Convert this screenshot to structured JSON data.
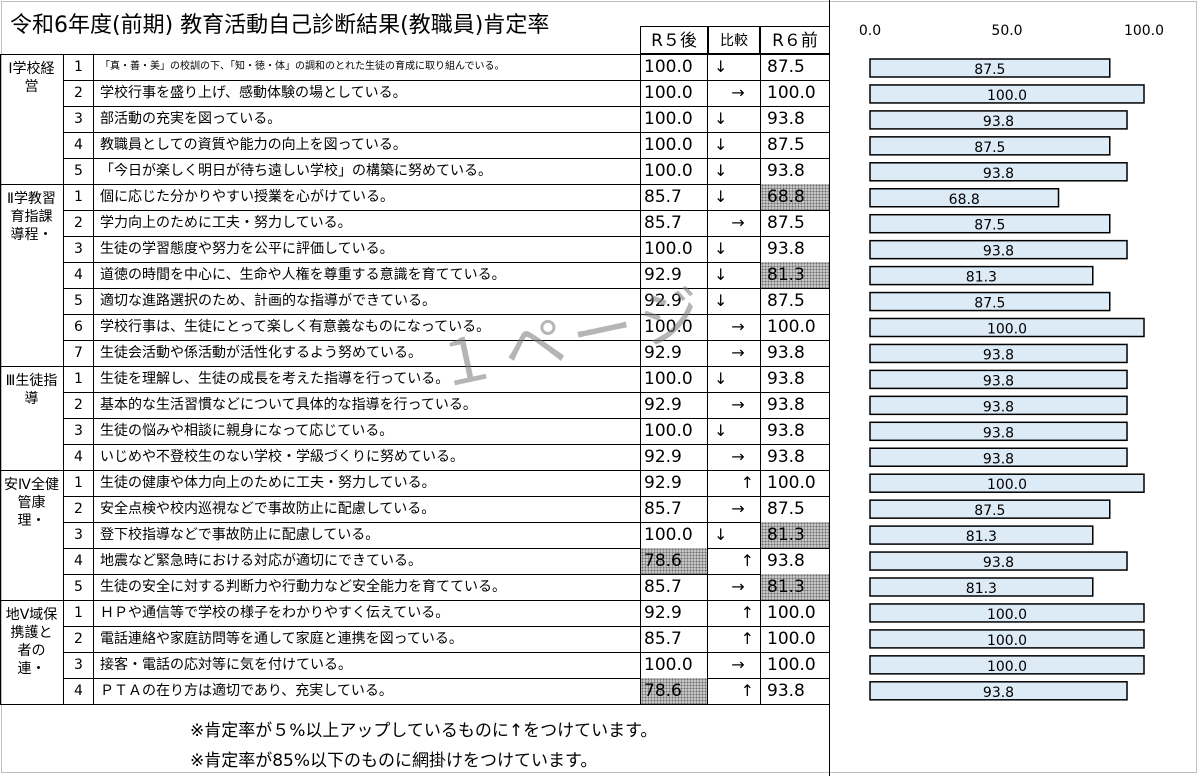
{
  "title": "令和6年度(前期)  教育活動自己診断結果(教職員)肯定率",
  "headers": {
    "r5": "R５後",
    "cmp": "比較",
    "r6": "R６前"
  },
  "categories": [
    {
      "label": "Ⅰ学校経営",
      "rows": [
        {
          "no": "1",
          "item": "「真・善・美」の校訓の下、「知・徳・体」の調和のとれた生徒の育成に取り組んでいる。",
          "small": true,
          "r5": "100.0",
          "cmp": "↓",
          "r6": "87.5"
        },
        {
          "no": "2",
          "item": "学校行事を盛り上げ、感動体験の場としている。",
          "r5": "100.0",
          "cmp": "→",
          "r6": "100.0"
        },
        {
          "no": "3",
          "item": "部活動の充実を図っている。",
          "r5": "100.0",
          "cmp": "↓",
          "r6": "93.8"
        },
        {
          "no": "4",
          "item": "教職員としての資質や能力の向上を図っている。",
          "r5": "100.0",
          "cmp": "↓",
          "r6": "87.5"
        },
        {
          "no": "5",
          "item": "「今日が楽しく明日が待ち遠しい学校」の構築に努めている。",
          "r5": "100.0",
          "cmp": "↓",
          "r6": "93.8"
        }
      ]
    },
    {
      "label": "Ⅱ学教習育指課導程・",
      "rows": [
        {
          "no": "1",
          "item": "個に応じた分かりやすい授業を心がけている。",
          "r5": "85.7",
          "cmp": "↓",
          "r6": "68.8",
          "r6_shade": true
        },
        {
          "no": "2",
          "item": "学力向上のために工夫・努力している。",
          "r5": "85.7",
          "cmp": "→",
          "r6": "87.5"
        },
        {
          "no": "3",
          "item": "生徒の学習態度や努力を公平に評価している。",
          "r5": "100.0",
          "cmp": "↓",
          "r6": "93.8"
        },
        {
          "no": "4",
          "item": "道徳の時間を中心に、生命や人権を尊重する意識を育てている。",
          "r5": "92.9",
          "cmp": "↓",
          "r6": "81.3",
          "r6_shade": true
        },
        {
          "no": "5",
          "item": "適切な進路選択のため、計画的な指導ができている。",
          "r5": "92.9",
          "cmp": "↓",
          "r6": "87.5"
        },
        {
          "no": "6",
          "item": "学校行事は、生徒にとって楽しく有意義なものになっている。",
          "r5": "100.0",
          "cmp": "→",
          "r6": "100.0"
        },
        {
          "no": "7",
          "item": "生徒会活動や係活動が活性化するよう努めている。",
          "r5": "92.9",
          "cmp": "→",
          "r6": "93.8"
        }
      ]
    },
    {
      "label": "Ⅲ生徒指導",
      "rows": [
        {
          "no": "1",
          "item": "生徒を理解し、生徒の成長を考えた指導を行っている。",
          "r5": "100.0",
          "cmp": "↓",
          "r6": "93.8"
        },
        {
          "no": "2",
          "item": "基本的な生活習慣などについて具体的な指導を行っている。",
          "r5": "92.9",
          "cmp": "→",
          "r6": "93.8"
        },
        {
          "no": "3",
          "item": "生徒の悩みや相談に親身になって応じている。",
          "r5": "100.0",
          "cmp": "↓",
          "r6": "93.8"
        },
        {
          "no": "4",
          "item": "いじめや不登校生のない学校・学級づくりに努めている。",
          "r5": "92.9",
          "cmp": "→",
          "r6": "93.8"
        }
      ]
    },
    {
      "label": "安Ⅳ全健管康理・",
      "rows": [
        {
          "no": "1",
          "item": "生徒の健康や体力向上のために工夫・努力している。",
          "r5": "92.9",
          "cmp": "↑",
          "r6": "100.0"
        },
        {
          "no": "2",
          "item": "安全点検や校内巡視などで事故防止に配慮している。",
          "r5": "85.7",
          "cmp": "→",
          "r6": "87.5"
        },
        {
          "no": "3",
          "item": "登下校指導などで事故防止に配慮している。",
          "r5": "100.0",
          "cmp": "↓",
          "r6": "81.3",
          "r6_shade": true
        },
        {
          "no": "4",
          "item": "地震など緊急時における対応が適切にできている。",
          "r5": "78.6",
          "r5_shade": true,
          "cmp": "↑",
          "r6": "93.8"
        },
        {
          "no": "5",
          "item": "生徒の安全に対する判断力や行動力など安全能力を育てている。",
          "r5": "85.7",
          "cmp": "→",
          "r6": "81.3",
          "r6_shade": true
        }
      ]
    },
    {
      "label": "地Ⅴ域保携護と者の連・",
      "rows": [
        {
          "no": "1",
          "item": "ＨＰや通信等で学校の様子をわかりやすく伝えている。",
          "r5": "92.9",
          "cmp": "↑",
          "r6": "100.0"
        },
        {
          "no": "2",
          "item": "電話連絡や家庭訪問等を通して家庭と連携を図っている。",
          "r5": "85.7",
          "cmp": "↑",
          "r6": "100.0"
        },
        {
          "no": "3",
          "item": "接客・電話の応対等に気を付けている。",
          "r5": "100.0",
          "cmp": "→",
          "r6": "100.0"
        },
        {
          "no": "4",
          "item": "ＰＴＡの在り方は適切であり、充実している。",
          "r5": "78.6",
          "r5_shade": true,
          "cmp": "↑",
          "r6": "93.8"
        }
      ]
    }
  ],
  "notes": [
    "※肯定率が５%以上アップしているものに↑をつけています。",
    "※肯定率が85%以下のものに網掛けをつけています。"
  ],
  "watermark": "１ページ",
  "chart_data": {
    "type": "bar",
    "orientation": "horizontal",
    "title": "",
    "xlabel": "",
    "ylabel": "",
    "xlim": [
      0,
      100
    ],
    "x_ticks": [
      "0.0",
      "50.0",
      "100.0"
    ],
    "grid": false,
    "bar_color": "#ddebf7",
    "values": [
      87.5,
      100.0,
      93.8,
      87.5,
      93.8,
      68.8,
      87.5,
      93.8,
      81.3,
      87.5,
      100.0,
      93.8,
      93.8,
      93.8,
      93.8,
      93.8,
      100.0,
      87.5,
      81.3,
      93.8,
      81.3,
      100.0,
      100.0,
      100.0,
      93.8
    ],
    "labels": [
      "87.5",
      "100.0",
      "93.8",
      "87.5",
      "93.8",
      "68.8",
      "87.5",
      "93.8",
      "81.3",
      "87.5",
      "100.0",
      "93.8",
      "93.8",
      "93.8",
      "93.8",
      "93.8",
      "100.0",
      "87.5",
      "81.3",
      "93.8",
      "81.3",
      "100.0",
      "100.0",
      "100.0",
      "93.8"
    ]
  }
}
